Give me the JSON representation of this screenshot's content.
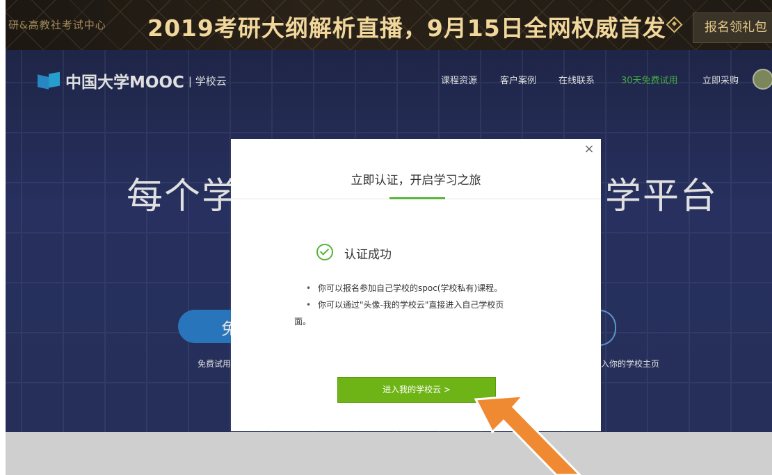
{
  "promo": {
    "left_text": "研&高教社考试中心",
    "headline": "2019考研大纲解析直播，9月15日全网权威首发",
    "button_label": "报名领礼包"
  },
  "header": {
    "logo_text": "中国大学MOOC",
    "logo_suffix": "| 学校云",
    "nav": [
      "课程资源",
      "客户案例",
      "在线联系",
      "30天免费试用",
      "立即采购"
    ]
  },
  "hero": {
    "title_left": "每个学",
    "title_right": "学平台",
    "button_text": "免",
    "small_left": "免费试用了",
    "small_right": "入你的学校主页"
  },
  "modal": {
    "title": "立即认证，开启学习之旅",
    "close_glyph": "×",
    "success_text": "认证成功",
    "bullets": [
      "你可以报名参加自己学校的spoc(学校私有)课程。",
      "你可以通过\"头像-我的学校云\"直接进入自己学校页"
    ],
    "bullet2_cont": "面。",
    "enter_button": "进入我的学校云 >"
  },
  "colors": {
    "accent_green": "#6fb416",
    "tab_green": "#57b537",
    "hero_bg": "#2c3666",
    "arrow_orange": "#f08a32"
  },
  "icons": [
    "logo-mark-icon",
    "diamond-icon",
    "avatar-icon",
    "close-icon",
    "check-circle-icon",
    "arrow-pointer-icon"
  ]
}
